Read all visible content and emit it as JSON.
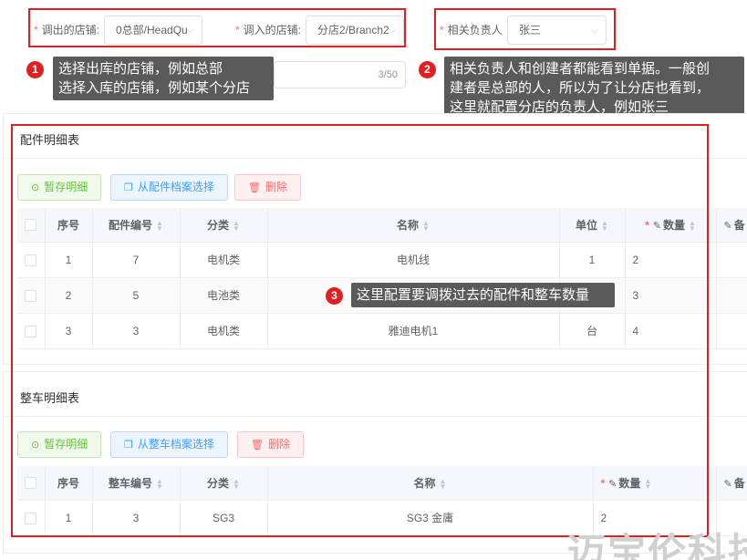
{
  "form": {
    "out_store_label": "调出的店铺:",
    "out_store_value": "0总部/HeadQu",
    "in_store_label": "调入的店铺:",
    "in_store_value": "分店2/Branch2",
    "person_label": "相关负责人",
    "person_value": "张三",
    "required_mark": "*",
    "remark_counter": "3/50"
  },
  "callouts": [
    {
      "num": "1",
      "text_lines": [
        "选择出库的店铺，例如总部",
        "选择入库的店铺，例如某个分店"
      ]
    },
    {
      "num": "2",
      "text_lines": [
        "相关负责人和创建者都能看到单据。一般创",
        "建者是总部的人，所以为了让分店也看到，",
        "这里就配置分店的负责人，例如张三"
      ]
    },
    {
      "num": "3",
      "text_lines": [
        "这里配置要调拨过去的配件和整车数量"
      ]
    }
  ],
  "parts_section": {
    "title": "配件明细表",
    "buttons": {
      "save": "暂存明细",
      "select": "从配件档案选择",
      "delete": "删除"
    },
    "columns": [
      "序号",
      "配件编号",
      "分类",
      "名称",
      "单位",
      "数量",
      "备"
    ],
    "rows": [
      {
        "seq": "1",
        "code": "7",
        "category": "电机类",
        "name": "电机线",
        "unit": "1",
        "qty": "2"
      },
      {
        "seq": "2",
        "code": "5",
        "category": "电池类",
        "name": "",
        "unit": "",
        "qty": "3"
      },
      {
        "seq": "3",
        "code": "3",
        "category": "电机类",
        "name": "雅迪电机1",
        "unit": "台",
        "qty": "4"
      }
    ]
  },
  "vehicle_section": {
    "title": "整车明细表",
    "buttons": {
      "save": "暂存明细",
      "select": "从整车档案选择",
      "delete": "删除"
    },
    "columns": [
      "序号",
      "整车编号",
      "分类",
      "名称",
      "数量",
      "备"
    ],
    "rows": [
      {
        "seq": "1",
        "code": "3",
        "category": "SG3",
        "name": "SG3 金庸",
        "qty": "2"
      }
    ]
  },
  "watermark": "迈宝伦科技",
  "colors": {
    "annotation_red": "#e02020",
    "callout_bg": "#5a5a5a",
    "success": "#67c23a",
    "primary": "#409eff",
    "danger": "#f56c6c"
  }
}
